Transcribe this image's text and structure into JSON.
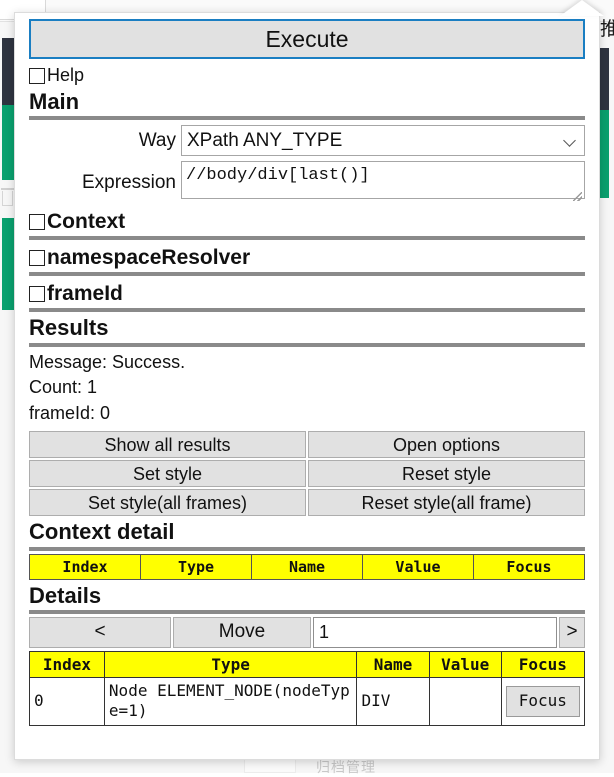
{
  "popup": {
    "execute_label": "Execute",
    "help_label": "Help",
    "sections": {
      "main": "Main",
      "results": "Results",
      "context_detail": "Context detail",
      "details": "Details"
    },
    "main": {
      "way_label": "Way",
      "way_value": "XPath ANY_TYPE",
      "way_icon": "chevron-down-icon",
      "expression_label": "Expression",
      "expression_value": "//body/div[last()]"
    },
    "toggles": [
      {
        "label": "Context",
        "checked": false
      },
      {
        "label": "namespaceResolver",
        "checked": false
      },
      {
        "label": "frameId",
        "checked": false
      }
    ],
    "results": {
      "message": "Message: Success.",
      "count": "Count: 1",
      "frame_id": "frameId: 0"
    },
    "action_buttons": [
      "Show all results",
      "Open options",
      "Set style",
      "Reset style",
      "Set style(all frames)",
      "Reset style(all frame)"
    ],
    "context_detail": {
      "columns": [
        "Index",
        "Type",
        "Name",
        "Value",
        "Focus"
      ],
      "rows": []
    },
    "move_bar": {
      "prev_label": "<",
      "move_label": "Move",
      "index_value": "1",
      "next_label": ">"
    },
    "details_table": {
      "columns": [
        "Index",
        "Type",
        "Name",
        "Value",
        "Focus"
      ],
      "rows": [
        {
          "index": "0",
          "type": "Node ELEMENT_NODE(nodeType=1)",
          "name": "DIV",
          "value": "",
          "focus_label": "Focus"
        }
      ]
    }
  },
  "background": {
    "side_text": "推",
    "bottom_text": "归档管理",
    "colors": {
      "accent_green": "#0aa06e",
      "accent_dark": "#2f3440",
      "focus_blue": "#1a7ec2",
      "table_header_yellow": "#ffff00"
    }
  }
}
